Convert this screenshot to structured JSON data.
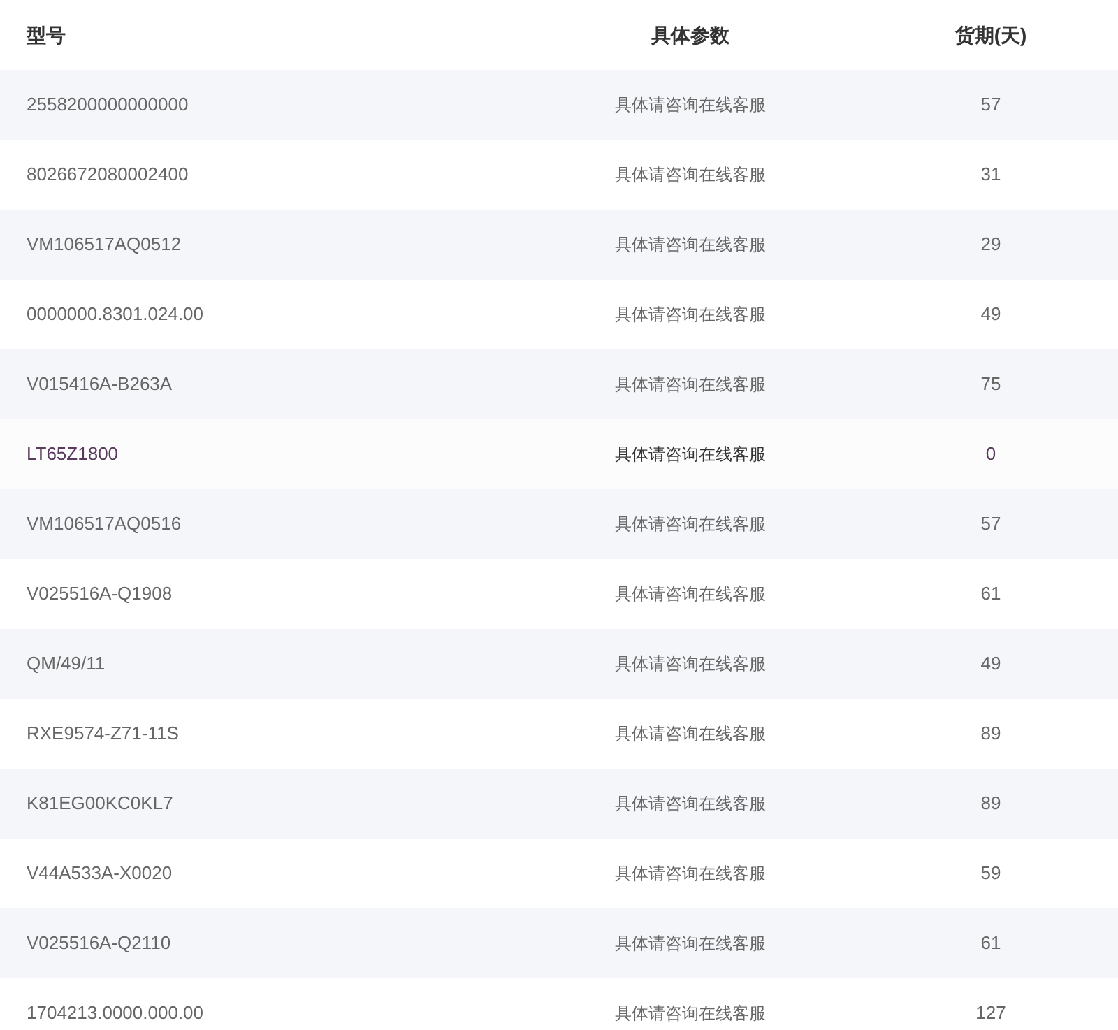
{
  "table": {
    "columns": [
      "型号",
      "具体参数",
      "货期(天)"
    ],
    "rows": [
      {
        "model": "2558200000000000",
        "params": "具体请咨询在线客服",
        "days": "57",
        "selected": false
      },
      {
        "model": "8026672080002400",
        "params": "具体请咨询在线客服",
        "days": "31",
        "selected": false
      },
      {
        "model": "VM106517AQ0512",
        "params": "具体请咨询在线客服",
        "days": "29",
        "selected": false
      },
      {
        "model": "0000000.8301.024.00",
        "params": "具体请咨询在线客服",
        "days": "49",
        "selected": false
      },
      {
        "model": "V015416A-B263A",
        "params": "具体请咨询在线客服",
        "days": "75",
        "selected": false
      },
      {
        "model": "LT65Z1800",
        "params": "具体请咨询在线客服",
        "days": "0",
        "selected": true
      },
      {
        "model": "VM106517AQ0516",
        "params": "具体请咨询在线客服",
        "days": "57",
        "selected": false
      },
      {
        "model": "V025516A-Q1908",
        "params": "具体请咨询在线客服",
        "days": "61",
        "selected": false
      },
      {
        "model": "QM/49/11",
        "params": "具体请咨询在线客服",
        "days": "49",
        "selected": false
      },
      {
        "model": "RXE9574-Z71-11S",
        "params": "具体请咨询在线客服",
        "days": "89",
        "selected": false
      },
      {
        "model": "K81EG00KC0KL7",
        "params": "具体请咨询在线客服",
        "days": "89",
        "selected": false
      },
      {
        "model": "V44A533A-X0020",
        "params": "具体请咨询在线客服",
        "days": "59",
        "selected": false
      },
      {
        "model": "V025516A-Q2110",
        "params": "具体请咨询在线客服",
        "days": "61",
        "selected": false
      },
      {
        "model": "1704213.0000.000.00",
        "params": "具体请咨询在线客服",
        "days": "127",
        "selected": false
      }
    ]
  }
}
